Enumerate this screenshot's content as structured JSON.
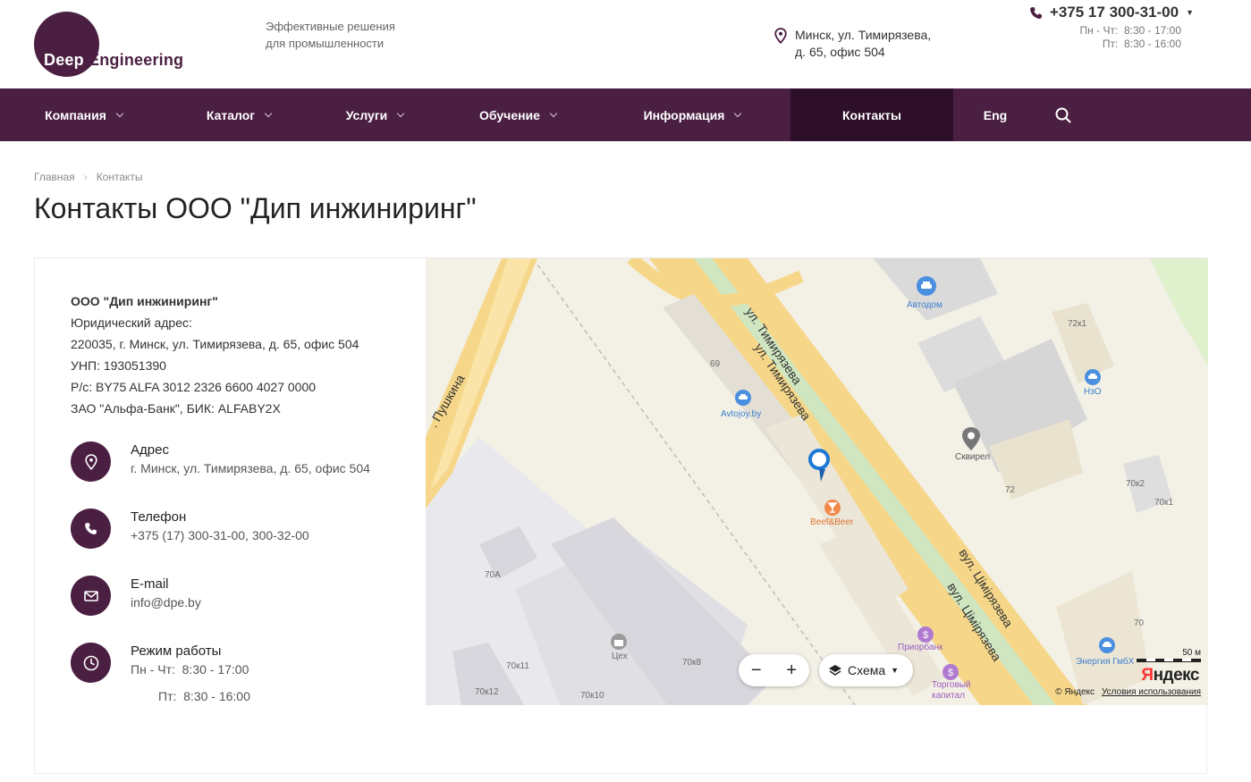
{
  "header": {
    "logo_word1": "Deep",
    "logo_word2": "Engineering",
    "tagline_line1": "Эффективные решения",
    "tagline_line2": "для промышленности",
    "address_line1": "Минск, ул. Тимирязева,",
    "address_line2": "д. 65, офис 504",
    "phone": "+375 17 300-31-00",
    "hours_line1": "Пн - Чт:  8:30 - 17:00",
    "hours_line2": "Пт:  8:30 - 16:00"
  },
  "nav": {
    "items": [
      {
        "label": "Компания"
      },
      {
        "label": "Каталог"
      },
      {
        "label": "Услуги"
      },
      {
        "label": "Обучение"
      },
      {
        "label": "Информация"
      },
      {
        "label": "Контакты"
      },
      {
        "label": "Eng"
      }
    ]
  },
  "breadcrumb": {
    "home": "Главная",
    "current": "Контакты"
  },
  "page_title": "Контакты ООО \"Дип инжиниринг\"",
  "company": {
    "name": "ООО \"Дип инжиниринг\"",
    "legal_label": "Юридический адрес:",
    "legal_address": "220035, г. Минск, ул. Тимирязева, д. 65, офис 504",
    "unp": "УНП: 193051390",
    "account": "Р/с: BY75 ALFA 3012 2326 6600 4027 0000",
    "bank": "ЗАО \"Альфа-Банк\", БИК: ALFABY2X"
  },
  "contacts": {
    "address_title": "Адрес",
    "address_value": "г. Минск, ул. Тимирязева, д. 65, офис 504",
    "phone_title": "Телефон",
    "phone_value": "+375 (17) 300-31-00, 300-32-00",
    "email_title": "E-mail",
    "email_value": "info@dpe.by",
    "hours_title": "Режим работы",
    "hours_value1": "Пн - Чт:  8:30 - 17:00",
    "hours_value2": "Пт:  8:30 - 16:00"
  },
  "map": {
    "streets": [
      "ул. Тимирязева",
      "ул. Тимирязева",
      "вул. Цімірязева",
      "вул. Цімірязева",
      ". Пушкина"
    ],
    "pois": [
      "Автодом",
      "Avtojoy.by",
      "НзО",
      "Сквирел",
      "Beef&Beer",
      "Приорбанк",
      "Торговый",
      "капитал",
      "Энергия ГмбХ",
      "Цех"
    ],
    "buildings": [
      "72к1",
      "69",
      "72",
      "70к2",
      "70к1",
      "70А",
      "70",
      "70к11",
      "70к8",
      "70к12",
      "70к10"
    ],
    "zoom_out": "−",
    "zoom_in": "+",
    "scheme_label": "Схема",
    "scale_label": "50 м",
    "copyright": "© Яндекс",
    "terms": "Условия использования",
    "brand_y": "Я",
    "brand_rest": "ндекс"
  },
  "colors": {
    "brand": "#4b1f42",
    "nav_active": "#2e0f29"
  }
}
